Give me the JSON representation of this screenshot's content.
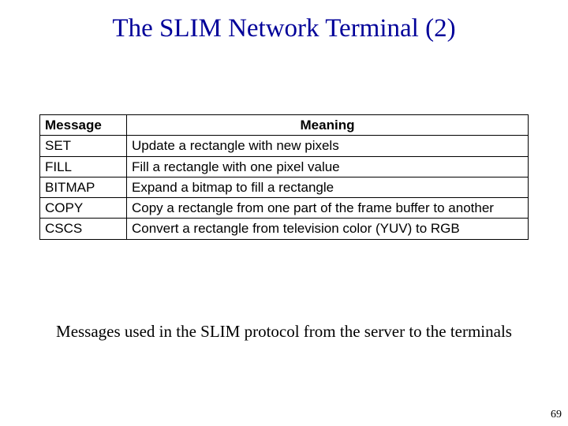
{
  "title": "The SLIM Network Terminal (2)",
  "table": {
    "headers": {
      "message": "Message",
      "meaning": "Meaning"
    },
    "rows": [
      {
        "message": "SET",
        "meaning": "Update a rectangle with new pixels"
      },
      {
        "message": "FILL",
        "meaning": "Fill a rectangle with one pixel value"
      },
      {
        "message": "BITMAP",
        "meaning": "Expand a bitmap to fill a rectangle"
      },
      {
        "message": "COPY",
        "meaning": "Copy a rectangle from one part of the frame buffer to another"
      },
      {
        "message": "CSCS",
        "meaning": "Convert a rectangle from television color (YUV) to RGB"
      }
    ]
  },
  "caption": "Messages used in the SLIM protocol from the server to the terminals",
  "page_number": "69"
}
